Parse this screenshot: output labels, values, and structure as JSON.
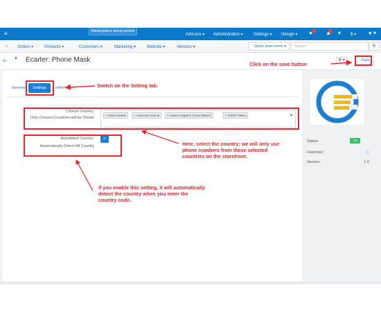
{
  "topbar": {
    "wizard_label": "Marketplace setup wizard",
    "menus": [
      "Add-ons",
      "Administration",
      "Settings",
      "Design"
    ],
    "currency_symbol": "$"
  },
  "navbar": {
    "items": [
      "Orders",
      "Products",
      "Customers",
      "Marketing",
      "Website",
      "Vendors"
    ],
    "quick_start": "Quick start menu",
    "search_placeholder": "Search"
  },
  "titlebar": {
    "title": "Ecarter: Phone Mask",
    "save_label": "Save"
  },
  "tabs": {
    "general": "General",
    "settings": "Settings",
    "information": "Information"
  },
  "fields": {
    "choose_country_label": "Choose Country:",
    "choose_country_hint": "Only Chosen Countries will be Shown",
    "countries": [
      "Aland Islands",
      "American Samoa",
      "United Kingdom (Great Britain)",
      "United States"
    ],
    "autodetect_label": "Autodetect Country:",
    "autodetect_hint": "Automatically Detect All Country",
    "autodetect_checked": true
  },
  "annotations": {
    "save": "Click on the save button",
    "settings_tab": "Switch on the Setting tab.",
    "country_line1": "Here, select the country; we will only use",
    "country_line2": "phone numbers from these selected",
    "country_line3": "countries on the storefront.",
    "auto_line1": "If you enable this setting, it will automatically",
    "auto_line2": "detect the country when you enter the",
    "auto_line3": "country code."
  },
  "sidebar": {
    "status_label": "Status:",
    "status_value": "ON",
    "favorites_label": "Favorites:",
    "version_label": "Version:",
    "version_value": "1.0"
  },
  "colors": {
    "primary": "#0b79c9",
    "annotation_red": "#e3262d",
    "status_green": "#3ebd69"
  }
}
